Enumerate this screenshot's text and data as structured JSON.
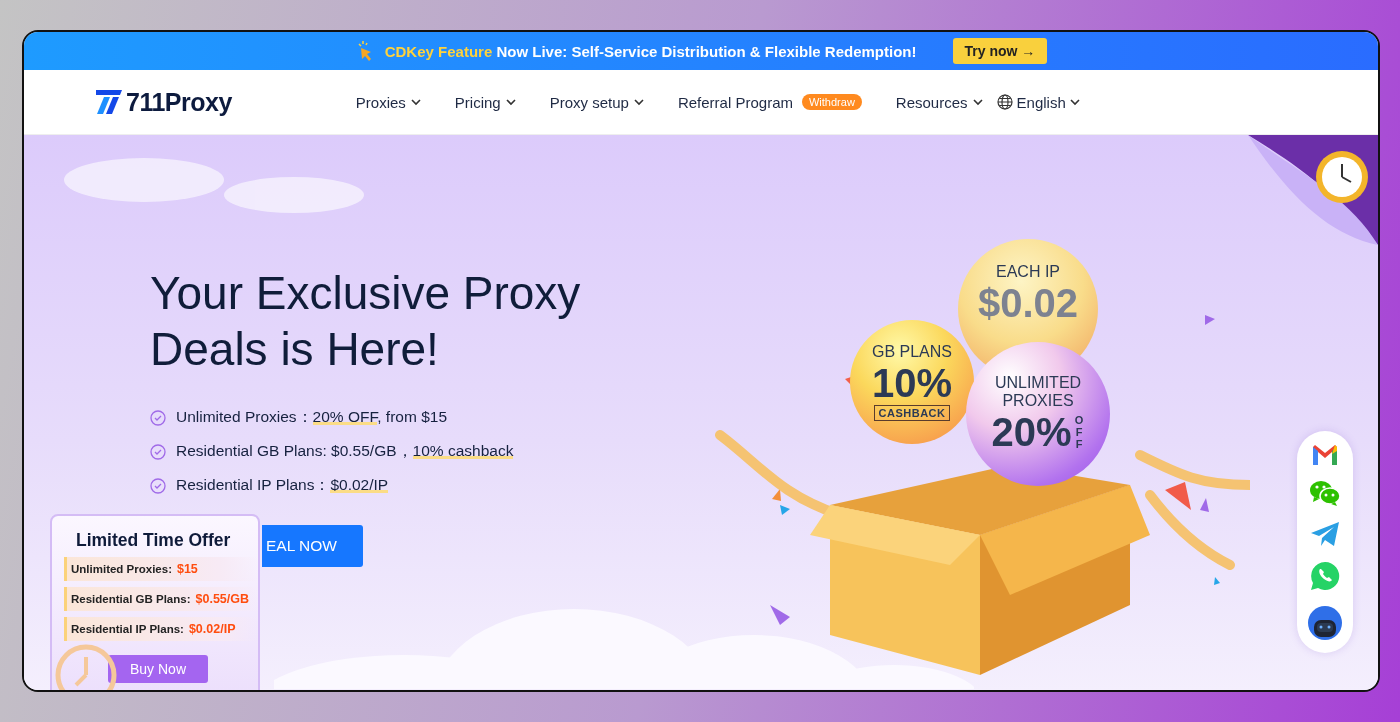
{
  "announcement": {
    "highlight": "CDKey Feature",
    "text": "Now Live: Self-Service Distribution & Flexible Redemption!",
    "button": "Try now →"
  },
  "logo": {
    "text": "711Proxy"
  },
  "nav": {
    "items": [
      {
        "label": "Proxies",
        "caret": true
      },
      {
        "label": "Pricing",
        "caret": true
      },
      {
        "label": "Proxy setup",
        "caret": true
      },
      {
        "label": "Referral Program",
        "caret": false,
        "badge": "Withdraw"
      },
      {
        "label": "Resources",
        "caret": true
      }
    ],
    "language": {
      "label": "English"
    }
  },
  "hero": {
    "title": "Your Exclusive Proxy Deals is Here!",
    "features": [
      {
        "text": "Unlimited Proxies：",
        "highlight": "20% OFF",
        "after": ", from $15"
      },
      {
        "text": "Residential GB Plans: $0.55/GB，",
        "highlight": "10% cashback"
      },
      {
        "text": "Residential IP Plans：",
        "highlight": "$0.02/IP"
      }
    ],
    "cta": "EAL NOW",
    "balloons": [
      {
        "top": "GB PLANS",
        "big": "10%",
        "tag": "CASHBACK"
      },
      {
        "top": "EACH IP",
        "big": "$0.02"
      },
      {
        "top": "UNLIMITED PROXIES",
        "big": "20%",
        "side": "OFF"
      }
    ]
  },
  "offer": {
    "title": "Limited Time Offer",
    "rows": [
      {
        "label": "Unlimited Proxies:",
        "price": "$15"
      },
      {
        "label": "Residential GB Plans:",
        "price": "$0.55/GB"
      },
      {
        "label": "Residential IP Plans:",
        "price": "$0.02/IP"
      }
    ],
    "button": "Buy Now"
  },
  "contacts": [
    {
      "kind": "gmail"
    },
    {
      "kind": "wechat"
    },
    {
      "kind": "telegram"
    },
    {
      "kind": "whatsapp"
    },
    {
      "kind": "bot"
    }
  ]
}
